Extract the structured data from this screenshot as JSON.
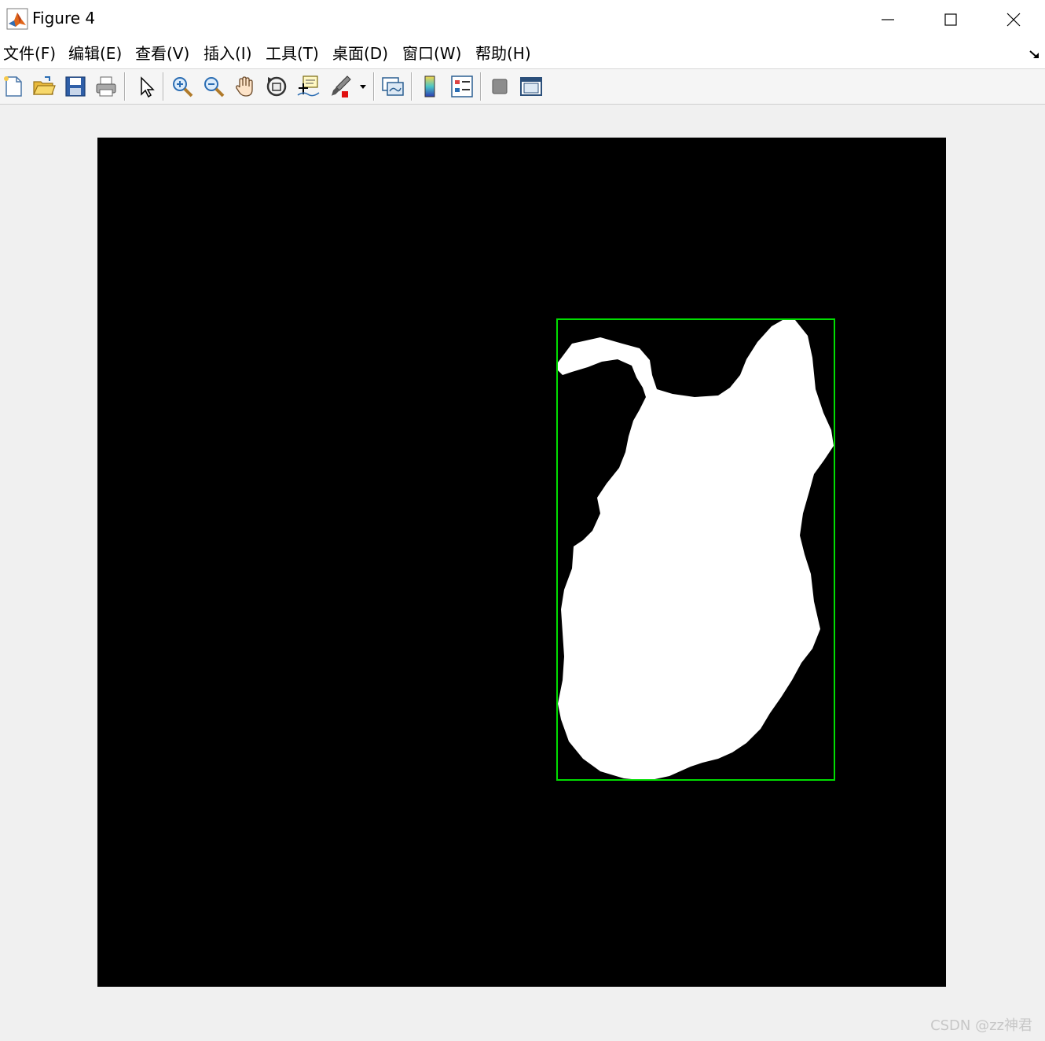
{
  "window": {
    "title": "Figure 4",
    "controls": {
      "minimize": "minimize-icon",
      "maximize": "maximize-icon",
      "close": "close-icon"
    }
  },
  "menubar": {
    "items": [
      {
        "label": "文件(F)"
      },
      {
        "label": "编辑(E)"
      },
      {
        "label": "查看(V)"
      },
      {
        "label": "插入(I)"
      },
      {
        "label": "工具(T)"
      },
      {
        "label": "桌面(D)"
      },
      {
        "label": "窗口(W)"
      },
      {
        "label": "帮助(H)"
      }
    ]
  },
  "toolbar": {
    "buttons": [
      {
        "icon": "new-figure-icon"
      },
      {
        "icon": "open-file-icon"
      },
      {
        "icon": "save-icon"
      },
      {
        "icon": "print-icon"
      },
      {
        "icon": "edit-plot-arrow-icon"
      },
      {
        "icon": "zoom-in-icon"
      },
      {
        "icon": "zoom-out-icon"
      },
      {
        "icon": "pan-hand-icon"
      },
      {
        "icon": "rotate-3d-icon"
      },
      {
        "icon": "data-cursor-icon"
      },
      {
        "icon": "brush-icon"
      },
      {
        "icon": "link-plot-icon"
      },
      {
        "icon": "colorbar-icon"
      },
      {
        "icon": "legend-icon"
      },
      {
        "icon": "hide-plot-tools-icon"
      },
      {
        "icon": "show-plot-tools-icon"
      }
    ]
  },
  "figure": {
    "image_background": "#000000",
    "blob_color": "#ffffff",
    "bounding_box_color": "#00dd00"
  },
  "watermark": "CSDN @zz神君"
}
